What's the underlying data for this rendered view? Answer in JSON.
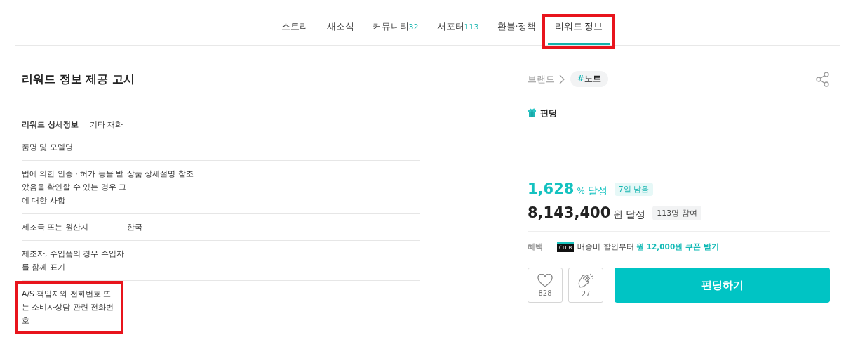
{
  "tabs": [
    {
      "label": "스토리",
      "selected": false,
      "highlighted": false
    },
    {
      "label": "새소식",
      "selected": false,
      "highlighted": false
    },
    {
      "label": "커뮤니티",
      "count": "32",
      "selected": false,
      "highlighted": false
    },
    {
      "label": "서포터",
      "count": "113",
      "selected": false,
      "highlighted": false
    },
    {
      "label": "환불·정책",
      "selected": false,
      "highlighted": false
    },
    {
      "label": "리워드 정보",
      "selected": true,
      "highlighted": true
    }
  ],
  "notice": {
    "title": "리워드 정보 제공 고시",
    "rows": [
      {
        "kind": "header",
        "label": "리워드 상세정보",
        "value": "기타 재화",
        "highlighted": false
      },
      {
        "kind": "row",
        "label": "품명 및 모델명",
        "highlighted": false
      },
      {
        "kind": "row",
        "label": "법에 의한 인증 · 허가 등을 받았음을 확인할 수 있는 경우 그에 대한 사항",
        "value": "상품 상세설명 참조",
        "highlighted": false
      },
      {
        "kind": "row",
        "label": "제조국 또는 원산지",
        "value": "한국",
        "highlighted": false
      },
      {
        "kind": "row",
        "label": "제조자, 수입품의 경우 수입자를 함께 표기",
        "highlighted": false
      },
      {
        "kind": "row",
        "label": "A/S 책임자와 전화번호 또는 소비자상담 관련 전화번호",
        "highlighted": true
      }
    ]
  },
  "sidebar": {
    "breadcrumb": "브랜드",
    "tag_hash": "#",
    "tag": "노트",
    "category": "펀딩",
    "percent": "1,628",
    "percent_unit": "%",
    "percent_label": "달성",
    "days_left": "7일 남음",
    "amount": "8,143,400",
    "amount_unit": "원",
    "amount_label": "달성",
    "supporters": "113명 참여",
    "benefit_label": "혜택",
    "club_badge": "CLUB",
    "benefit_text": "배송비 할인부터",
    "benefit_highlight": "원 12,000원 쿠폰 받기",
    "like_count": "828",
    "cheer_count": "27",
    "fund_button": "펀딩하기"
  }
}
